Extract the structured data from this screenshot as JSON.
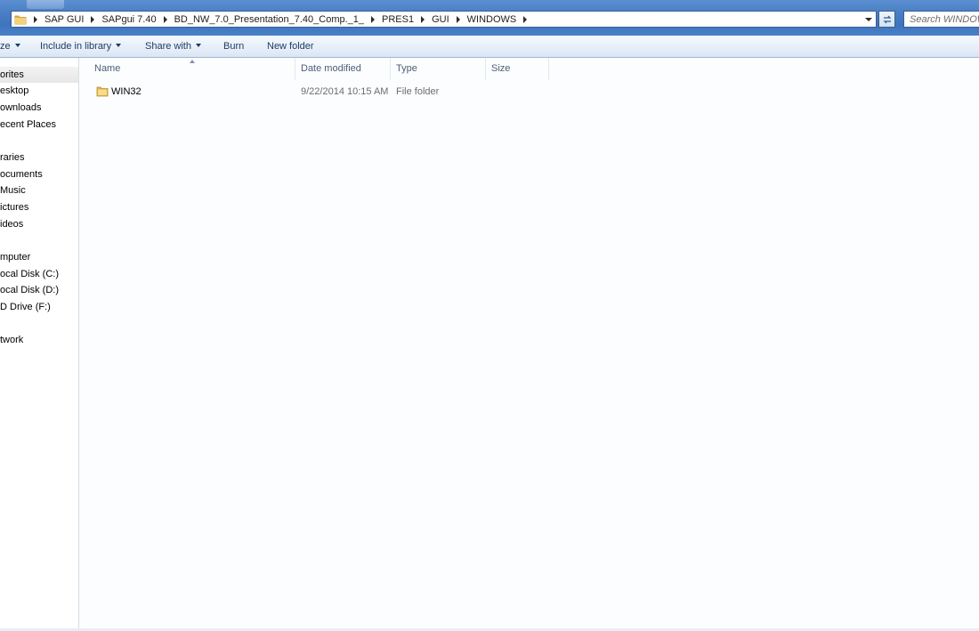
{
  "address": {
    "crumbs": [
      "SAP GUI",
      "SAPgui 7.40",
      "BD_NW_7.0_Presentation_7.40_Comp._1_",
      "PRES1",
      "GUI",
      "WINDOWS"
    ],
    "search_placeholder": "Search WINDOWS"
  },
  "commandbar": {
    "organize": "ze",
    "include_in_library": "Include in library",
    "share_with": "Share with",
    "burn": "Burn",
    "new_folder": "New folder"
  },
  "nav": {
    "favorites": "orites",
    "desktop": "esktop",
    "downloads": "ownloads",
    "recent_places": "ecent Places",
    "libraries": "raries",
    "documents": "ocuments",
    "music": "Music",
    "pictures": "ictures",
    "videos": "ideos",
    "computer": "mputer",
    "local_c": "ocal Disk (C:)",
    "local_d": "ocal Disk (D:)",
    "dvd": "D Drive (F:)",
    "network": "twork"
  },
  "columns": {
    "name": "Name",
    "date_modified": "Date modified",
    "type": "Type",
    "size": "Size"
  },
  "rows": [
    {
      "name": "WIN32",
      "date_modified": "9/22/2014 10:15 AM",
      "type": "File folder",
      "size": "",
      "icon": "folder-icon"
    }
  ],
  "colors": {
    "titlebar": "#4a7fc6",
    "commandbar": "#e8f0fa",
    "text": "#1e395b",
    "header_text": "#4c607a",
    "folder": "#e8c35a"
  }
}
